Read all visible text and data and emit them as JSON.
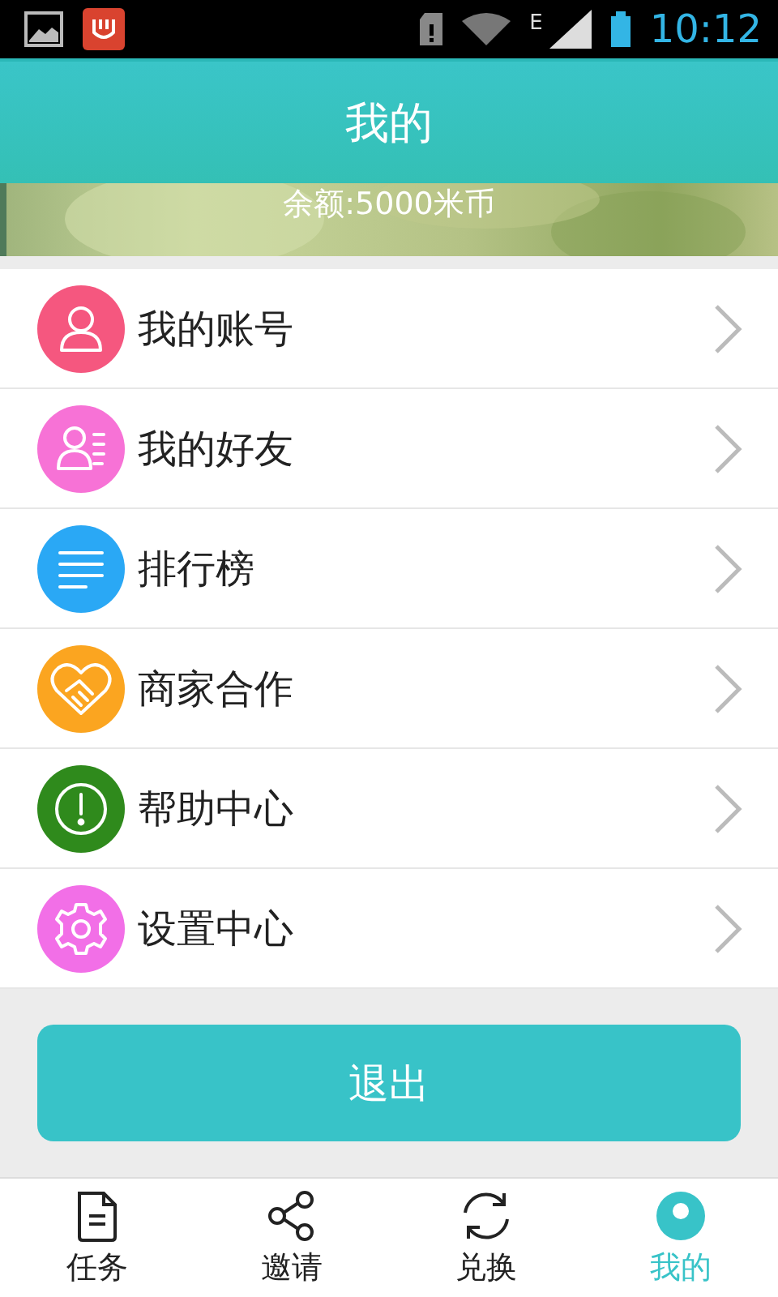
{
  "status_bar": {
    "network": "E",
    "time": "10:12"
  },
  "header": {
    "title": "我的"
  },
  "banner": {
    "kind": "picture",
    "balance": "余额:5000米币"
  },
  "menu": [
    {
      "kind": "account",
      "label": "我的账号",
      "color": "#f5577f"
    },
    {
      "kind": "friends",
      "label": "我的好友",
      "color": "#f772d6"
    },
    {
      "kind": "ranking",
      "label": "排行榜",
      "color": "#2aa8f5"
    },
    {
      "kind": "partner",
      "label": "商家合作",
      "color": "#fba520"
    },
    {
      "kind": "help",
      "label": "帮助中心",
      "color": "#2f8a1c"
    },
    {
      "kind": "settings",
      "label": "设置中心",
      "color": "#f26fe7"
    }
  ],
  "logout_button": "退出",
  "bottom_nav": [
    {
      "kind": "task",
      "label": "任务",
      "selected": false
    },
    {
      "kind": "share",
      "label": "邀请",
      "selected": false
    },
    {
      "kind": "exchange",
      "label": "兑换",
      "selected": false
    },
    {
      "kind": "profile",
      "label": "我的",
      "selected": true
    }
  ]
}
